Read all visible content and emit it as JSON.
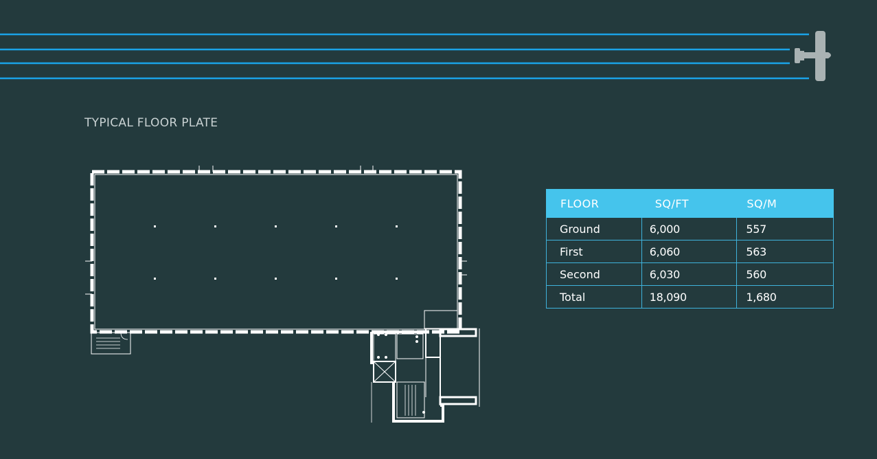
{
  "header": {
    "graphic": "flight-path-banner",
    "icon": "airplane-icon",
    "line_color": "#1aa3e8",
    "plane_color": "#a9b2b3"
  },
  "section": {
    "title": "TYPICAL FLOOR PLATE"
  },
  "floor_plan": {
    "description_icon": "floor-plan-drawing"
  },
  "area_table": {
    "headers": [
      "FLOOR",
      "SQ/FT",
      "SQ/M"
    ],
    "rows": [
      {
        "floor": "Ground",
        "sqft": "6,000",
        "sqm": "557"
      },
      {
        "floor": "First",
        "sqft": "6,060",
        "sqm": "563"
      },
      {
        "floor": "Second",
        "sqft": "6,030",
        "sqm": "560"
      },
      {
        "floor": "Total",
        "sqft": "18,090",
        "sqm": "1,680"
      }
    ]
  },
  "colors": {
    "background": "#233a3d",
    "table_header": "#45c4ec",
    "table_border": "#3fb3dd",
    "text": "#ffffff",
    "title_text": "#c9d2d3"
  }
}
